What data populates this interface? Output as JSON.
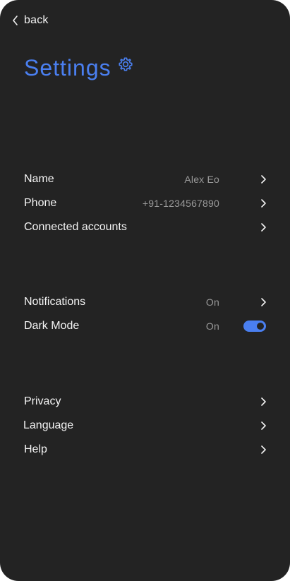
{
  "nav": {
    "back_label": "back",
    "back_icon": "chevron-left-icon"
  },
  "header": {
    "title": "Settings",
    "title_icon": "gear-icon"
  },
  "colors": {
    "accent": "#4a7ff0",
    "background": "#232323",
    "text": "#f4f4f4",
    "muted_text": "#9a9a9a"
  },
  "account": {
    "name": {
      "label": "Name",
      "value": "Alex Eo"
    },
    "phone": {
      "label": "Phone",
      "value": "+91-1234567890"
    },
    "connected": {
      "label": "Connected accounts"
    }
  },
  "preferences": {
    "notifications": {
      "label": "Notifications",
      "value": "On"
    },
    "dark_mode": {
      "label": "Dark Mode",
      "value": "On",
      "enabled": true
    }
  },
  "misc": {
    "privacy": {
      "label": "Privacy"
    },
    "language": {
      "label": "Language"
    },
    "help": {
      "label": "Help"
    }
  }
}
